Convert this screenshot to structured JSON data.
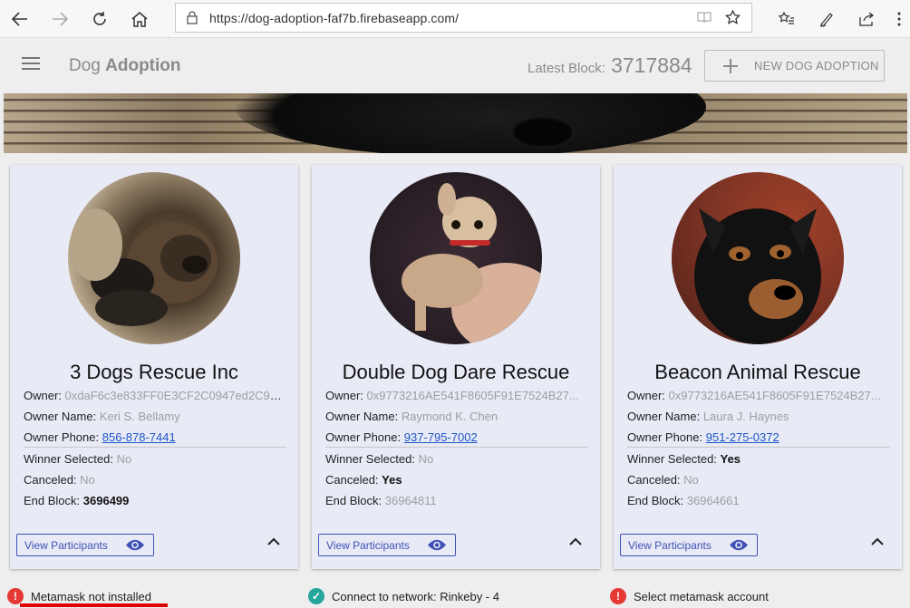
{
  "browser": {
    "url": "https://dog-adoption-faf7b.firebaseapp.com/"
  },
  "header": {
    "title_light": "Dog",
    "title_bold": "Adoption",
    "latest_block_label": "Latest Block:",
    "latest_block_value": "3717884",
    "new_button_label": "NEW DOG ADOPTION"
  },
  "cards": [
    {
      "title": "3 Dogs Rescue Inc",
      "owner_label": "Owner:",
      "owner": "0xdaF6c3e833FF0E3CF2C0947ed2C9A...",
      "owner_name_label": "Owner Name:",
      "owner_name": "Keri S. Bellamy",
      "owner_phone_label": "Owner Phone:",
      "owner_phone": "856-878-7441",
      "winner_label": "Winner Selected:",
      "winner": "No",
      "canceled_label": "Canceled:",
      "canceled": "No",
      "end_block_label": "End Block:",
      "end_block": "3696499",
      "view_label": "View Participants"
    },
    {
      "title": "Double Dog Dare Rescue",
      "owner_label": "Owner:",
      "owner": "0x9773216AE541F8605F91E7524B27...",
      "owner_name_label": "Owner Name:",
      "owner_name": "Raymond K. Chen",
      "owner_phone_label": "Owner Phone:",
      "owner_phone": "937-795-7002",
      "winner_label": "Winner Selected:",
      "winner": "No",
      "canceled_label": "Canceled:",
      "canceled": "Yes",
      "end_block_label": "End Block:",
      "end_block": "36964811",
      "view_label": "View Participants"
    },
    {
      "title": "Beacon Animal Rescue",
      "owner_label": "Owner:",
      "owner": "0x9773216AE541F8605F91E7524B27...",
      "owner_name_label": "Owner Name:",
      "owner_name": "Laura J. Haynes",
      "owner_phone_label": "Owner Phone:",
      "owner_phone": "951-275-0372",
      "winner_label": "Winner Selected:",
      "winner": "Yes",
      "canceled_label": "Canceled:",
      "canceled": "No",
      "end_block_label": "End Block:",
      "end_block": "36964661",
      "view_label": "View Participants"
    }
  ],
  "footer": {
    "metamask_status": "Metamask not installed",
    "network_status": "Connect to network: Rinkeby - 4",
    "account_status": "Select metamask account"
  },
  "colors": {
    "accent": "#3f51b5",
    "card_bg": "#e8eaf6",
    "error": "#e53935",
    "ok": "#26a69a"
  }
}
